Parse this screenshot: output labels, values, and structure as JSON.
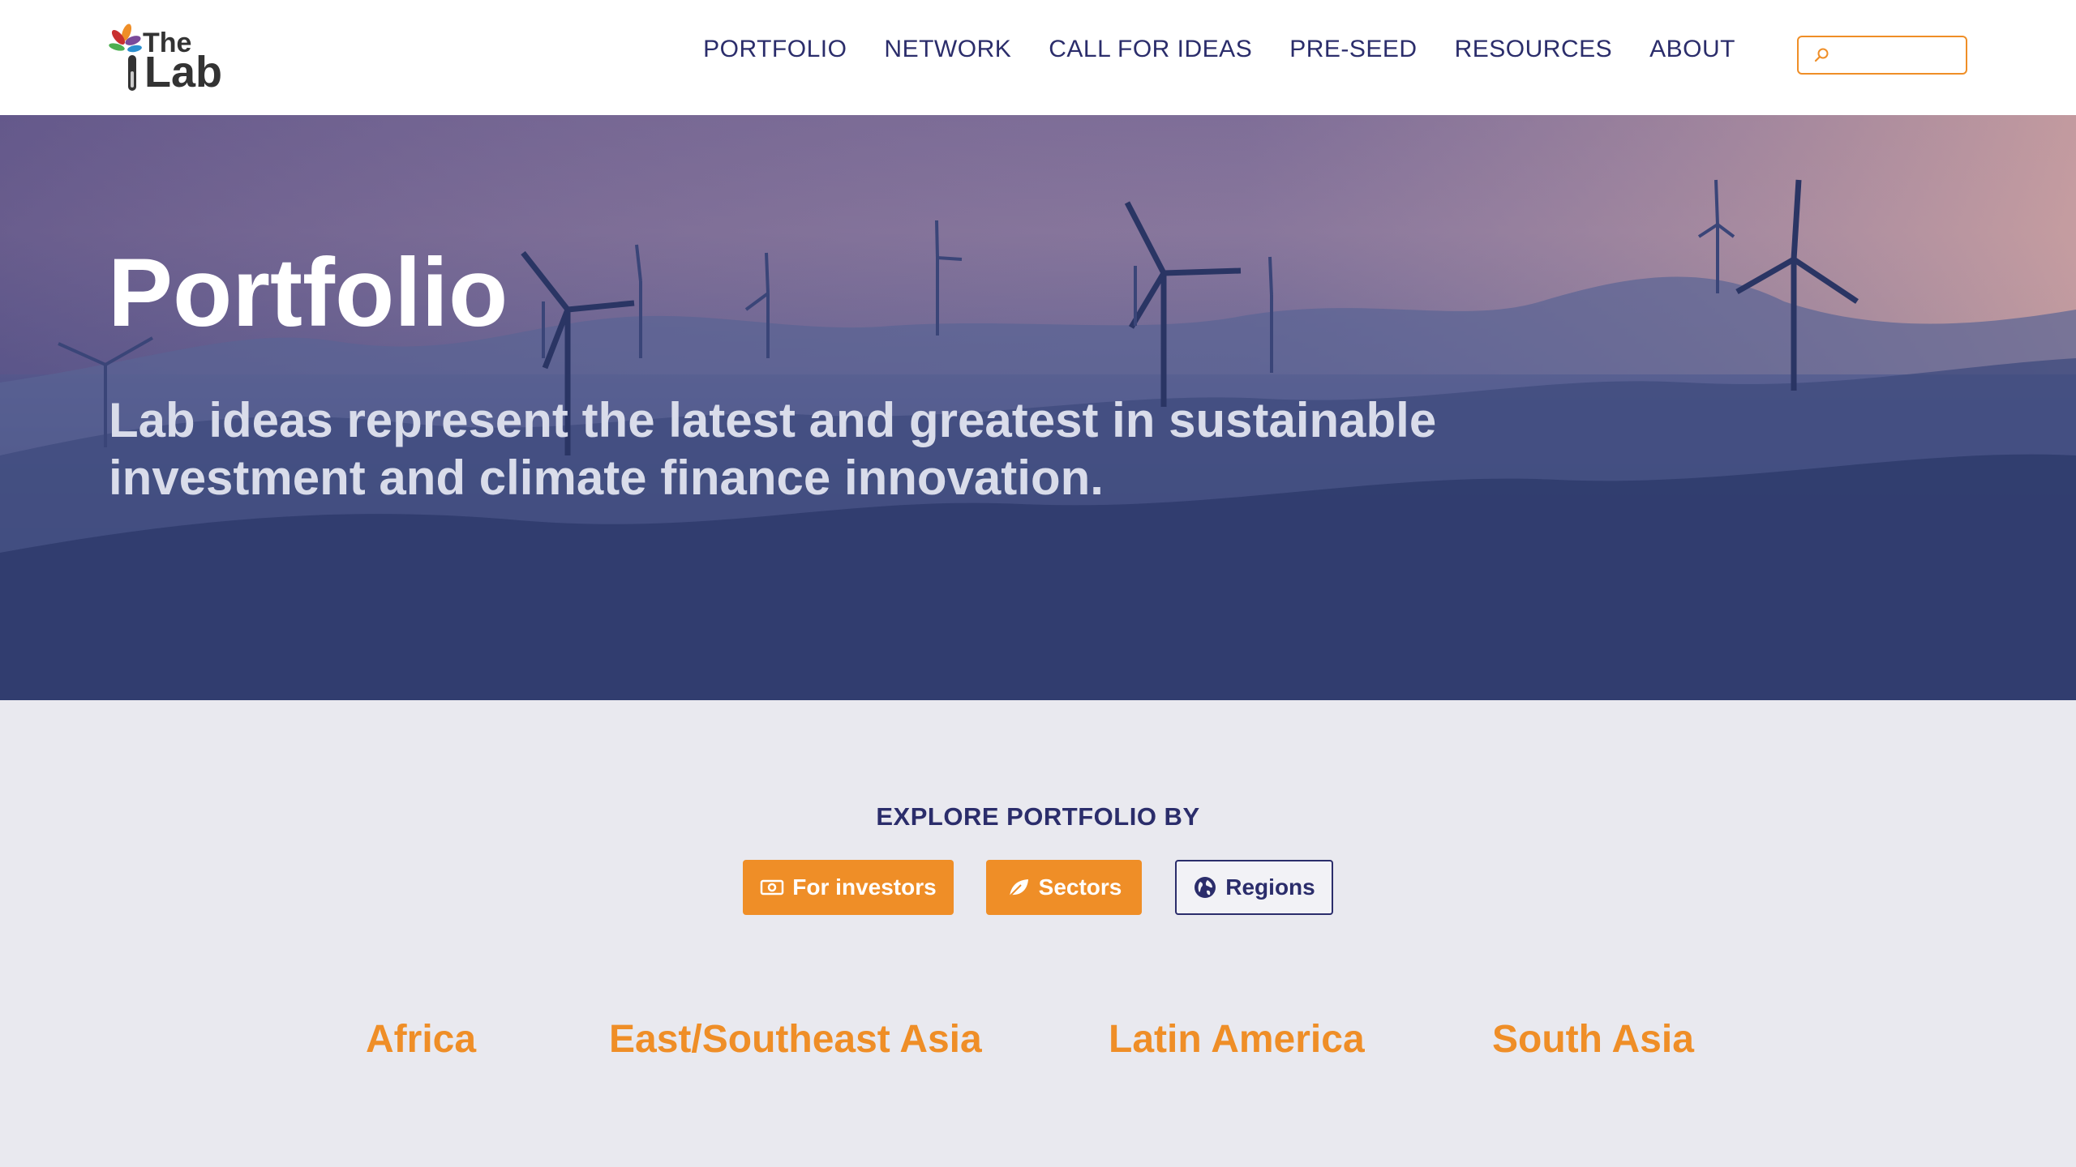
{
  "logo": {
    "line1": "The",
    "line2": "Lab"
  },
  "nav": {
    "items": [
      "PORTFOLIO",
      "NETWORK",
      "CALL FOR IDEAS",
      "PRE-SEED",
      "RESOURCES",
      "ABOUT"
    ]
  },
  "search": {
    "placeholder": "",
    "value": ""
  },
  "hero": {
    "title": "Portfolio",
    "subtitle": "Lab ideas represent the latest and greatest in sustainable investment and climate finance innovation."
  },
  "explore": {
    "title": "EXPLORE PORTFOLIO BY",
    "buttons": [
      "For investors",
      "Sectors",
      "Regions"
    ]
  },
  "regions": [
    "Africa",
    "East/Southeast Asia",
    "Latin America",
    "South Asia"
  ],
  "colors": {
    "accent": "#ef8e27",
    "navy": "#2b2d6b",
    "background": "#e9e9ef"
  }
}
